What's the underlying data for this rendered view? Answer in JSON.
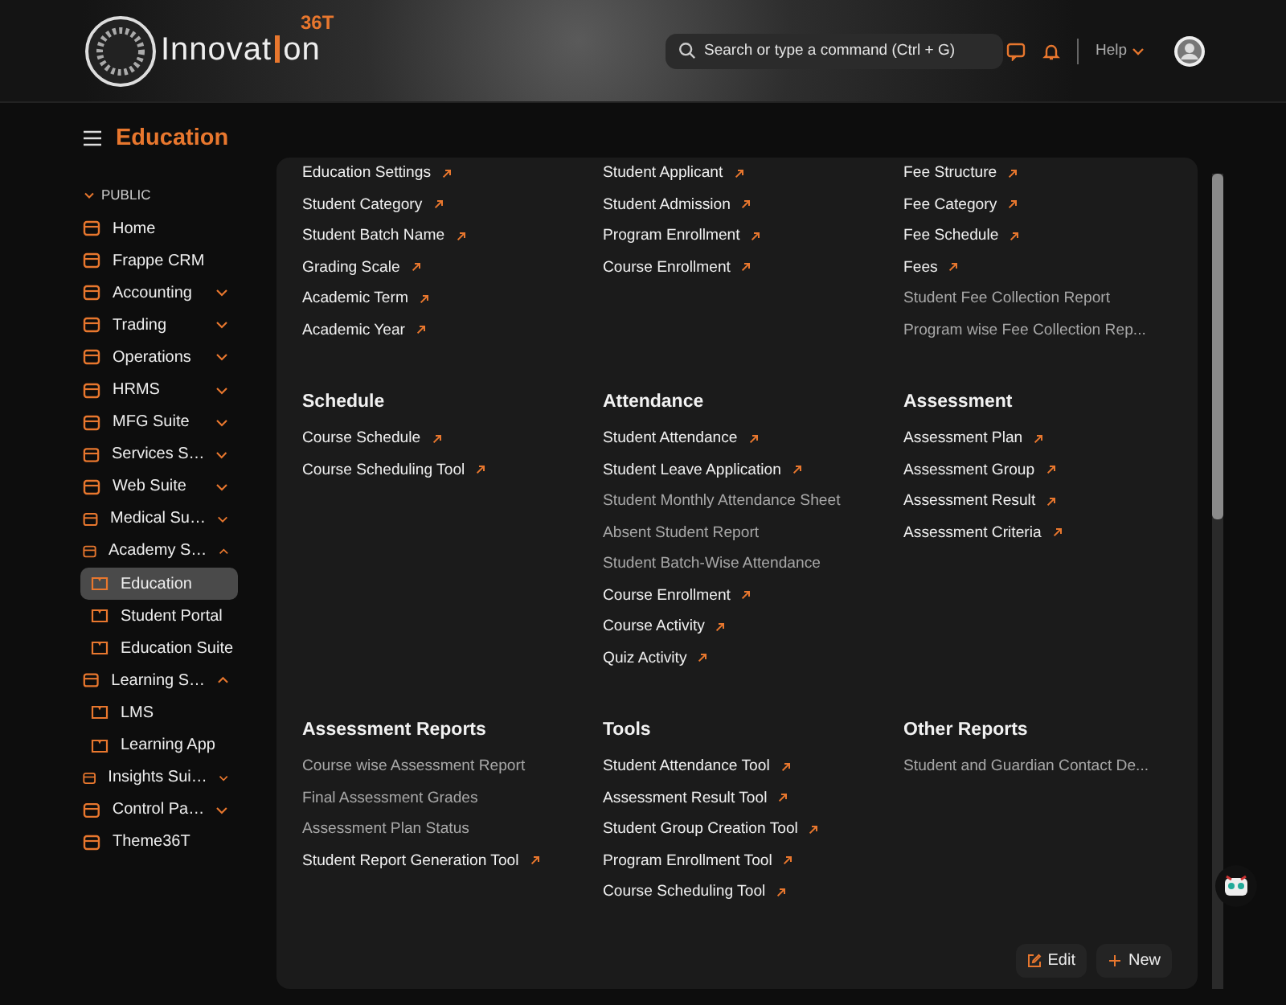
{
  "header": {
    "logo_text": "Innovat",
    "logo_text_end": "on",
    "logo_badge": "36T",
    "search": {
      "placeholder": "Search or type a command (Ctrl + G)"
    },
    "help": "Help"
  },
  "page_title": "Education",
  "sidebar": {
    "section": "PUBLIC",
    "section_expanded": true,
    "items": [
      {
        "label": "Home",
        "selected": false
      },
      {
        "label": "Frappe CRM",
        "selected": false
      },
      {
        "label": "Accounting",
        "selected": false,
        "expanded": false
      },
      {
        "label": "Trading",
        "selected": false,
        "expanded": false
      },
      {
        "label": "Operations",
        "selected": false,
        "expanded": false
      },
      {
        "label": "HRMS",
        "selected": false,
        "expanded": false
      },
      {
        "label": "MFG Suite",
        "selected": false,
        "expanded": false
      },
      {
        "label": "Services S…",
        "selected": false,
        "expanded": false
      },
      {
        "label": "Web Suite",
        "selected": false,
        "expanded": false
      },
      {
        "label": "Medical Su…",
        "selected": false,
        "expanded": false
      },
      {
        "label": "Academy S…",
        "selected": false,
        "expanded": true,
        "children": [
          {
            "label": "Education",
            "selected": true
          },
          {
            "label": "Student Portal",
            "selected": false
          },
          {
            "label": "Education Suite",
            "selected": false
          }
        ]
      },
      {
        "label": "Learning S…",
        "selected": false,
        "expanded": true,
        "children": [
          {
            "label": "LMS",
            "selected": false
          },
          {
            "label": "Learning App",
            "selected": false
          }
        ]
      },
      {
        "label": "Insights Sui…",
        "selected": false,
        "expanded": false
      },
      {
        "label": "Control Pa…",
        "selected": false,
        "expanded": false
      },
      {
        "label": "Theme36T",
        "selected": false
      }
    ]
  },
  "card": {
    "groups": [
      {
        "columns": [
          {
            "links": [
              {
                "label": "Education Settings",
                "kind": "link"
              },
              {
                "label": "Student Category",
                "kind": "link"
              },
              {
                "label": "Student Batch Name",
                "kind": "link"
              },
              {
                "label": "Grading Scale",
                "kind": "link"
              },
              {
                "label": "Academic Term",
                "kind": "link"
              },
              {
                "label": "Academic Year",
                "kind": "link"
              }
            ]
          },
          {
            "links": [
              {
                "label": "Student Applicant",
                "kind": "link"
              },
              {
                "label": "Student Admission",
                "kind": "link"
              },
              {
                "label": "Program Enrollment",
                "kind": "link"
              },
              {
                "label": "Course Enrollment",
                "kind": "link"
              }
            ]
          },
          {
            "links": [
              {
                "label": "Fee Structure",
                "kind": "link"
              },
              {
                "label": "Fee Category",
                "kind": "link"
              },
              {
                "label": "Fee Schedule",
                "kind": "link"
              },
              {
                "label": "Fees",
                "kind": "link"
              },
              {
                "label": "Student Fee Collection Report",
                "kind": "report"
              },
              {
                "label": "Program wise Fee Collection Rep...",
                "kind": "report"
              }
            ]
          }
        ]
      },
      {
        "columns": [
          {
            "title": "Schedule",
            "links": [
              {
                "label": "Course Schedule",
                "kind": "link"
              },
              {
                "label": "Course Scheduling Tool",
                "kind": "link"
              }
            ]
          },
          {
            "title": "Attendance",
            "links": [
              {
                "label": "Student Attendance",
                "kind": "link"
              },
              {
                "label": "Student Leave Application",
                "kind": "link"
              },
              {
                "label": "Student Monthly Attendance Sheet",
                "kind": "report"
              },
              {
                "label": "Absent Student Report",
                "kind": "report"
              },
              {
                "label": "Student Batch-Wise Attendance",
                "kind": "report"
              },
              {
                "label": "Course Enrollment",
                "kind": "link"
              },
              {
                "label": "Course Activity",
                "kind": "link"
              },
              {
                "label": "Quiz Activity",
                "kind": "link"
              }
            ]
          },
          {
            "title": "Assessment",
            "links": [
              {
                "label": "Assessment Plan",
                "kind": "link"
              },
              {
                "label": "Assessment Group",
                "kind": "link"
              },
              {
                "label": "Assessment Result",
                "kind": "link"
              },
              {
                "label": "Assessment Criteria",
                "kind": "link"
              }
            ]
          }
        ]
      },
      {
        "columns": [
          {
            "title": "Assessment Reports",
            "links": [
              {
                "label": "Course wise Assessment Report",
                "kind": "report"
              },
              {
                "label": "Final Assessment Grades",
                "kind": "report"
              },
              {
                "label": "Assessment Plan Status",
                "kind": "report"
              },
              {
                "label": "Student Report Generation Tool",
                "kind": "link"
              }
            ]
          },
          {
            "title": "Tools",
            "links": [
              {
                "label": "Student Attendance Tool",
                "kind": "link"
              },
              {
                "label": "Assessment Result Tool",
                "kind": "link"
              },
              {
                "label": "Student Group Creation Tool",
                "kind": "link"
              },
              {
                "label": "Program Enrollment Tool",
                "kind": "link"
              },
              {
                "label": "Course Scheduling Tool",
                "kind": "link"
              }
            ]
          },
          {
            "title": "Other Reports",
            "links": [
              {
                "label": "Student and Guardian Contact De...",
                "kind": "report"
              }
            ]
          }
        ]
      }
    ],
    "buttons": [
      {
        "label": "Edit",
        "kind": "edit"
      },
      {
        "label": "New",
        "kind": "new"
      }
    ]
  }
}
